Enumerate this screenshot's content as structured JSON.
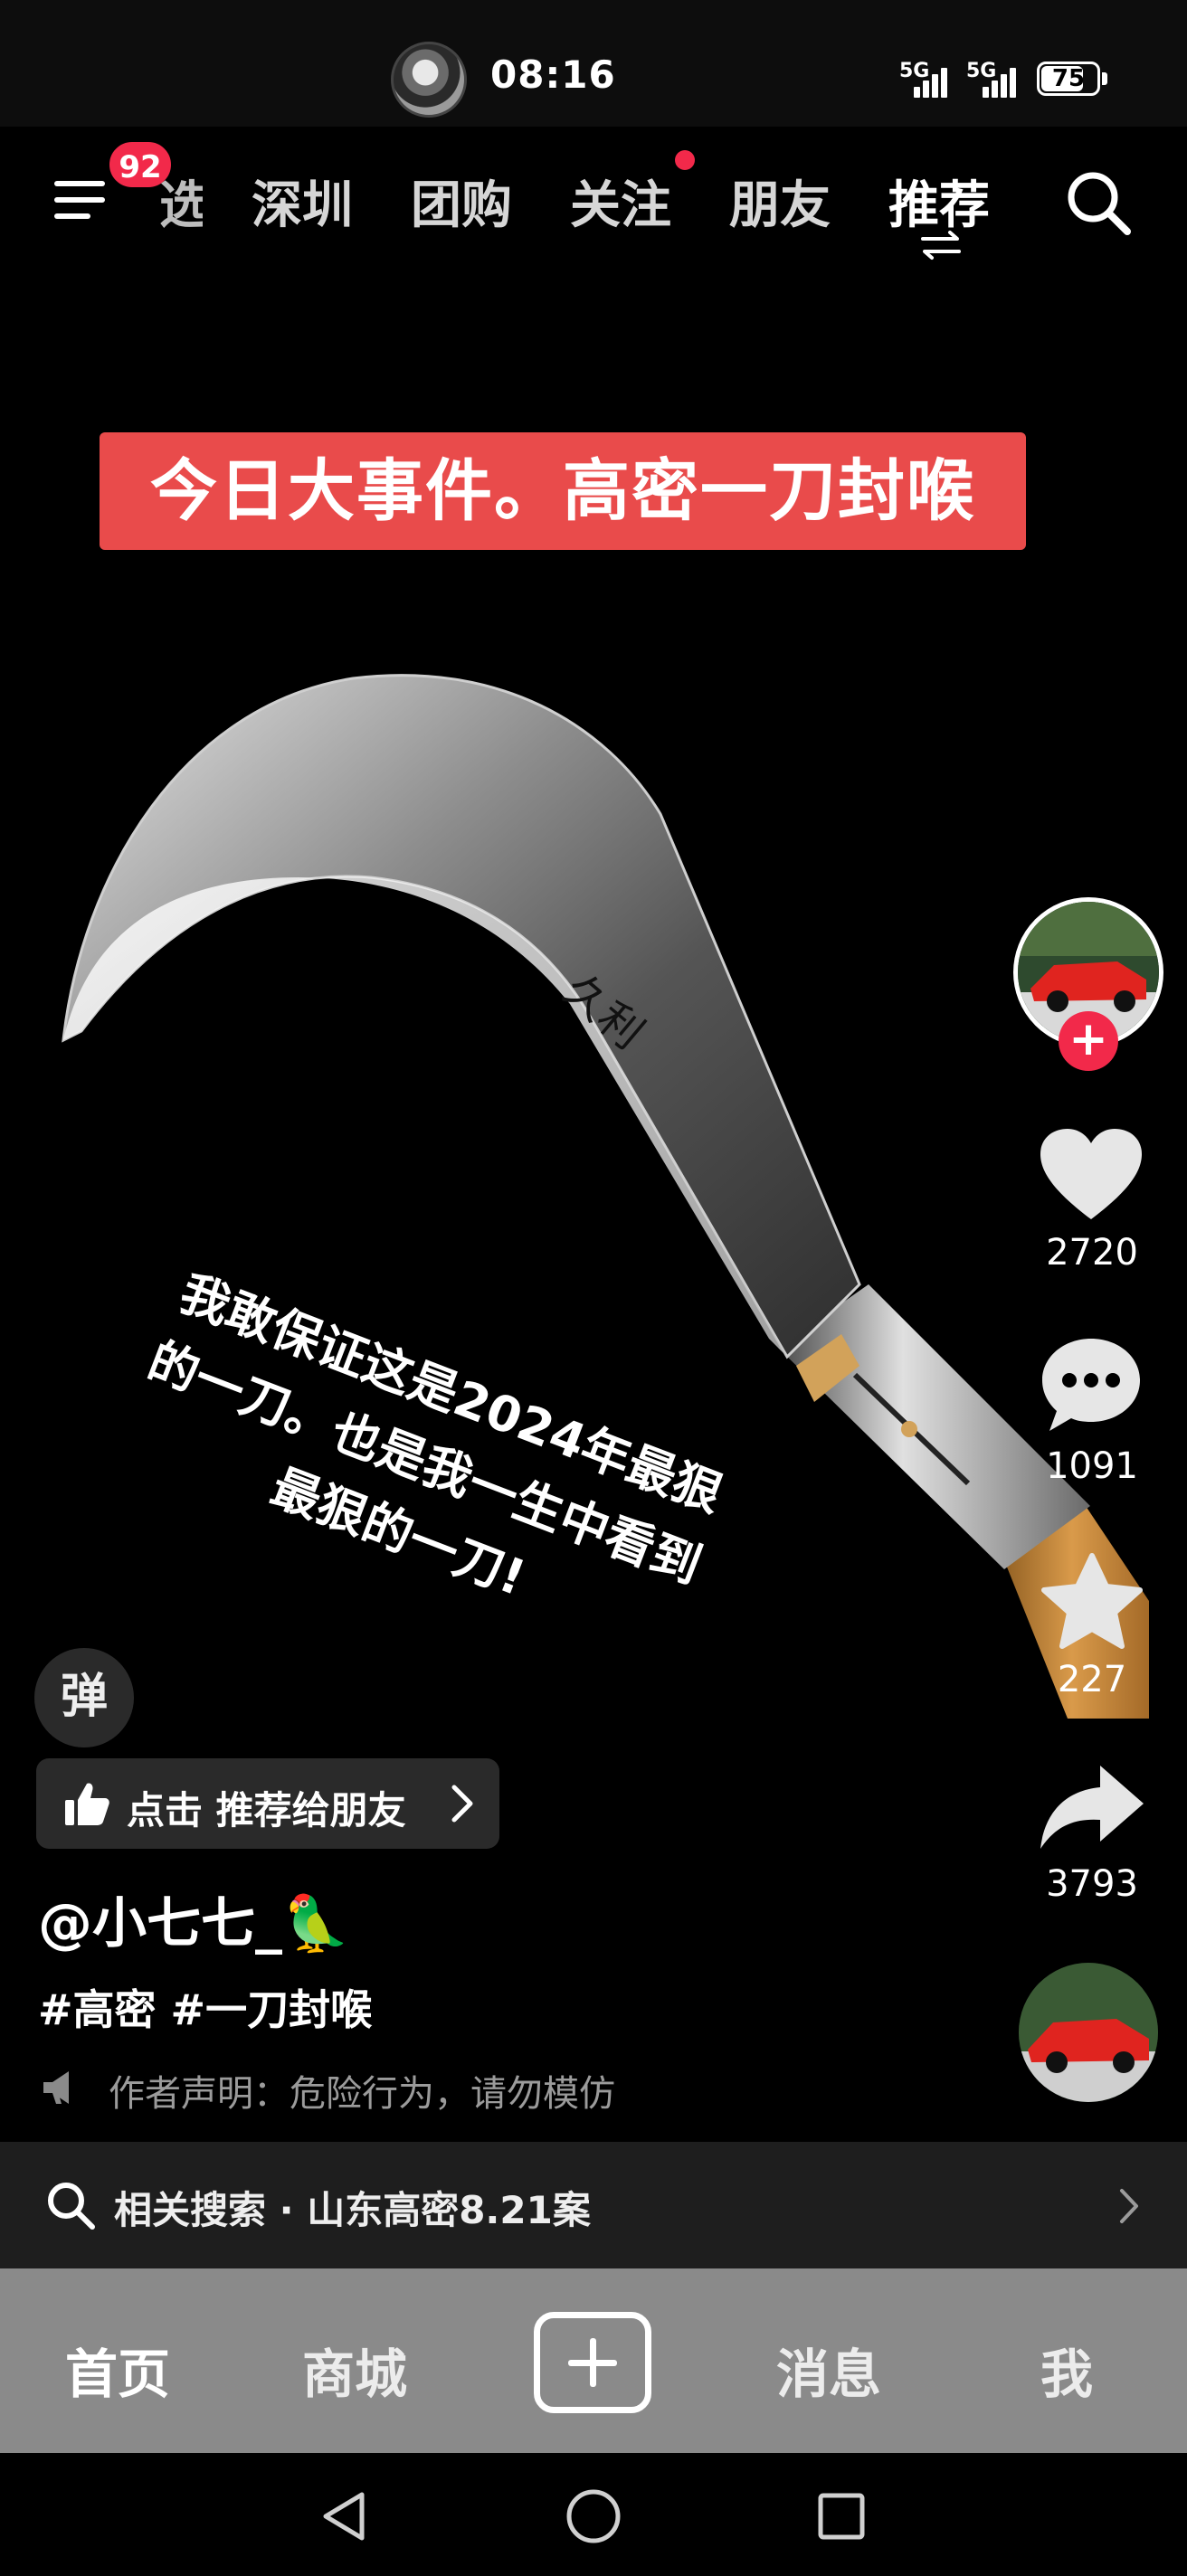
{
  "status_bar": {
    "time": "08:16",
    "network_1": "5G",
    "network_2": "5G",
    "battery": "75"
  },
  "top_nav": {
    "menu_badge": "92",
    "partial_tab": "选",
    "tabs": [
      "深圳",
      "团购",
      "关注",
      "朋友",
      "推荐"
    ],
    "active_tab": "推荐"
  },
  "video": {
    "title_banner": "今日大事件。高密一刀封喉",
    "blade_engraving": "久利",
    "caption_lines": [
      "我敢保证这是2024年最狠",
      "的一刀。也是我一生中看到",
      "最狠的一刀!"
    ]
  },
  "right_rail": {
    "like_count": "2720",
    "comment_count": "1091",
    "favorite_count": "227",
    "share_count": "3793"
  },
  "danmaku_label": "弹",
  "recommend_pill": {
    "label": "点击 推荐给朋友"
  },
  "post": {
    "username": "@小七七_🦜",
    "hashtags": "#高密 #一刀封喉",
    "disclaimer": "作者声明：危险行为，请勿模仿"
  },
  "related_search": {
    "text": "相关搜索 · 山东高密8.21案"
  },
  "bottom_tabs": {
    "home": "首页",
    "mall": "商城",
    "messages": "消息",
    "me": "我"
  },
  "colors": {
    "accent": "#f2294a",
    "banner": "#e94b4b",
    "tabbar": "#8a8a8a"
  }
}
